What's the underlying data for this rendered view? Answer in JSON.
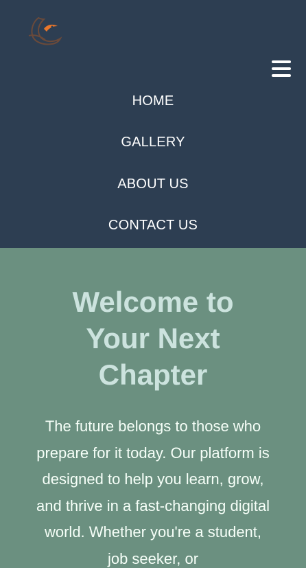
{
  "colors": {
    "header_bg": "#2d3e52",
    "hero_bg": "#6b9080",
    "hero_title": "#cce3de",
    "hero_text": "#f6fff8",
    "logo_accent": "#e8762b"
  },
  "header": {
    "logo_icon": "bird-logo-icon",
    "menu_icon": "hamburger-menu-icon",
    "nav": {
      "items": [
        {
          "label": "HOME"
        },
        {
          "label": "GALLERY"
        },
        {
          "label": "ABOUT US"
        },
        {
          "label": "CONTACT US"
        }
      ]
    }
  },
  "hero": {
    "title": "Welcome to Your Next Chapter",
    "text": "The future belongs to those who prepare for it today. Our platform is designed to help you learn, grow, and thrive in a fast-changing digital world. Whether you're a student, job seeker, or"
  }
}
